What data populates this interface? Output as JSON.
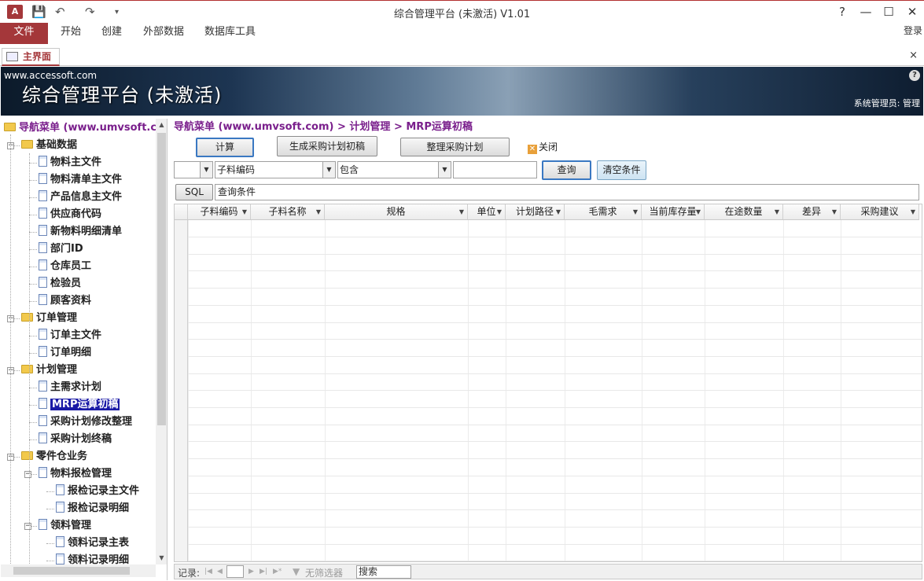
{
  "window": {
    "title": "综合管理平台 (未激活) V1.01",
    "help": "?",
    "minimize": "—",
    "maximize": "☐",
    "close": "✕",
    "app_icon": "A"
  },
  "ribbon": {
    "tabs": [
      "文件",
      "开始",
      "创建",
      "外部数据",
      "数据库工具"
    ],
    "login": "登录"
  },
  "doc_tab": {
    "label": "主界面",
    "close": "×"
  },
  "banner": {
    "site": "www.accessoft.com",
    "title": "综合管理平台 (未激活)",
    "user": "系统管理员: 管理",
    "help": "?"
  },
  "nav": {
    "root": "导航菜单 (www.umvsoft.com)",
    "items": [
      {
        "label": "基础数据",
        "type": "folder",
        "level": 1
      },
      {
        "label": "物料主文件",
        "type": "doc",
        "level": 2
      },
      {
        "label": "物料清单主文件",
        "type": "doc",
        "level": 2
      },
      {
        "label": "产品信息主文件",
        "type": "doc",
        "level": 2
      },
      {
        "label": "供应商代码",
        "type": "doc",
        "level": 2
      },
      {
        "label": "新物料明细清单",
        "type": "doc",
        "level": 2
      },
      {
        "label": "部门ID",
        "type": "doc",
        "level": 2
      },
      {
        "label": "仓库员工",
        "type": "doc",
        "level": 2
      },
      {
        "label": "检验员",
        "type": "doc",
        "level": 2
      },
      {
        "label": "顾客资料",
        "type": "doc",
        "level": 2
      },
      {
        "label": "订单管理",
        "type": "folder",
        "level": 1
      },
      {
        "label": "订单主文件",
        "type": "doc",
        "level": 2
      },
      {
        "label": "订单明细",
        "type": "doc",
        "level": 2
      },
      {
        "label": "计划管理",
        "type": "folder",
        "level": 1
      },
      {
        "label": "主需求计划",
        "type": "doc",
        "level": 2
      },
      {
        "label": "MRP运算初稿",
        "type": "doc",
        "level": 2,
        "selected": true
      },
      {
        "label": "采购计划修改整理",
        "type": "doc",
        "level": 2
      },
      {
        "label": "采购计划终稿",
        "type": "doc",
        "level": 2
      },
      {
        "label": "零件仓业务",
        "type": "folder",
        "level": 1
      },
      {
        "label": "物料报检管理",
        "type": "doc",
        "level": 2,
        "expander": true
      },
      {
        "label": "报检记录主文件",
        "type": "doc",
        "level": 3
      },
      {
        "label": "报检记录明细",
        "type": "doc",
        "level": 3
      },
      {
        "label": "领料管理",
        "type": "doc",
        "level": 2,
        "expander": true
      },
      {
        "label": "领料记录主表",
        "type": "doc",
        "level": 3
      },
      {
        "label": "领料记录明细",
        "type": "doc",
        "level": 3
      }
    ]
  },
  "main": {
    "breadcrumb": "导航菜单 (www.umvsoft.com) > 计划管理 > MRP运算初稿",
    "buttons": {
      "calc": "计算",
      "generate": "生成采购计划初稿",
      "organize": "整理采购计划",
      "close": "关闭",
      "query": "查询",
      "clear": "清空条件",
      "sql": "SQL"
    },
    "filter": {
      "logic": "",
      "field": "子料编码",
      "operator": "包含",
      "value": ""
    },
    "sql_text": "查询条件",
    "columns": [
      "子料编码",
      "子料名称",
      "规格",
      "单位",
      "计划路径",
      "毛需求",
      "当前库存量",
      "在途数量",
      "差异",
      "采购建议"
    ],
    "record_nav": {
      "label": "记录:",
      "no_filter": "无筛选器",
      "search": "搜索"
    }
  }
}
